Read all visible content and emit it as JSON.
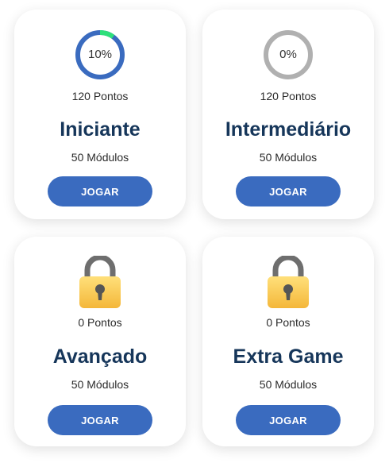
{
  "levels": [
    {
      "progress_label": "10%",
      "progress_value": 0.1,
      "points": "120 Pontos",
      "title": "Iniciante",
      "modules": "50 Módulos",
      "button": "JOGAR",
      "locked": false
    },
    {
      "progress_label": "0%",
      "progress_value": 0.0,
      "points": "120 Pontos",
      "title": "Intermediário",
      "modules": "50 Módulos",
      "button": "JOGAR",
      "locked": false
    },
    {
      "points": "0 Pontos",
      "title": "Avançado",
      "modules": "50 Módulos",
      "button": "JOGAR",
      "locked": true,
      "icon": "lock-icon"
    },
    {
      "points": "0 Pontos",
      "title": "Extra Game",
      "modules": "50 Módulos",
      "button": "JOGAR",
      "locked": true,
      "icon": "lock-icon"
    }
  ],
  "colors": {
    "progress_active": "#3a6bbf",
    "progress_done": "#2ee07a",
    "progress_empty": "#b0b0b0",
    "title": "#16365a",
    "button": "#3a6bbf",
    "lock_body": "#f6c24a",
    "lock_shackle": "#6e6e6e"
  }
}
